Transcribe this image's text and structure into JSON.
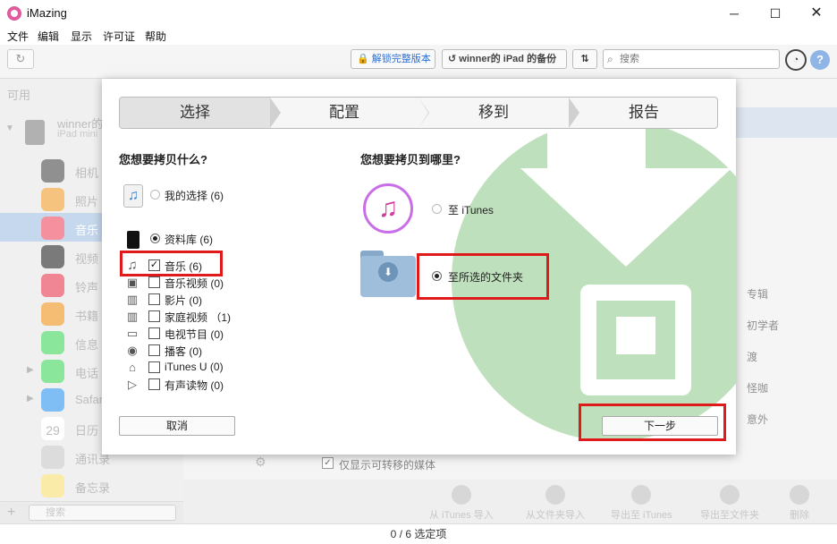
{
  "window": {
    "title": "iMazing",
    "min": "─",
    "max": "☐",
    "close": "✕"
  },
  "menu": [
    "文件",
    "编辑",
    "显示",
    "许可证",
    "帮助"
  ],
  "toolbar": {
    "unlock_label": "解锁完整版本",
    "backup_label": "winner的 iPad 的备份",
    "search_placeholder": "搜索"
  },
  "sidebar": {
    "header": "可用",
    "device_name": "winner的",
    "device_model": "iPad mini",
    "items": [
      {
        "label": "相机",
        "icon": "camera-icon",
        "color": "#555555"
      },
      {
        "label": "照片",
        "icon": "photos-icon",
        "color": "#f2a33a"
      },
      {
        "label": "音乐",
        "icon": "music-icon",
        "color": "#f0566b"
      },
      {
        "label": "视频",
        "icon": "video-icon",
        "color": "#333333"
      },
      {
        "label": "铃声",
        "icon": "ringtone-icon",
        "color": "#e8445a"
      },
      {
        "label": "书籍",
        "icon": "books-icon",
        "color": "#f09a2a"
      },
      {
        "label": "信息",
        "icon": "messages-icon",
        "color": "#4cd964"
      },
      {
        "label": "电话",
        "icon": "phone-icon",
        "color": "#4cd964"
      },
      {
        "label": "Safari",
        "icon": "safari-icon",
        "color": "#3a9bf0"
      },
      {
        "label": "日历",
        "icon": "calendar-icon",
        "color": "#ffffff"
      },
      {
        "label": "通讯录",
        "icon": "contacts-icon",
        "color": "#c9c9c9"
      },
      {
        "label": "备忘录",
        "icon": "notes-icon",
        "color": "#f7e27a"
      }
    ],
    "calendar_day": "29",
    "search_placeholder": "搜索"
  },
  "main": {
    "right_list": [
      "专辑",
      "初学者",
      "渡",
      "怪咖",
      "意外"
    ],
    "filter_label": "仅显示可转移的媒体",
    "bottom_tools": [
      "从 iTunes 导入",
      "从文件夹导入",
      "导出至 iTunes",
      "导出至文件夹",
      "删除"
    ]
  },
  "status": "0 / 6 选定项",
  "dialog": {
    "steps": [
      "选择",
      "配置",
      "移到",
      "报告"
    ],
    "active_step": "选择",
    "question_left": "您想要拷贝什么?",
    "question_right": "您想要拷贝到哪里?",
    "source_options": [
      {
        "label": "我的选择 (6)",
        "selected": false
      },
      {
        "label": "资料库 (6)",
        "selected": true
      }
    ],
    "categories": [
      {
        "label": "音乐 (6)",
        "checked": true,
        "icon": "music-note-icon"
      },
      {
        "label": "音乐视频 (0)",
        "checked": false,
        "icon": "music-video-icon"
      },
      {
        "label": "影片 (0)",
        "checked": false,
        "icon": "film-icon"
      },
      {
        "label": "家庭视频 （1)",
        "checked": false,
        "icon": "home-video-icon"
      },
      {
        "label": "电视节目 (0)",
        "checked": false,
        "icon": "tv-icon"
      },
      {
        "label": "播客 (0)",
        "checked": false,
        "icon": "podcast-icon"
      },
      {
        "label": "iTunes U (0)",
        "checked": false,
        "icon": "itunes-u-icon"
      },
      {
        "label": "有声读物 (0)",
        "checked": false,
        "icon": "audiobook-icon"
      }
    ],
    "destinations": [
      {
        "label": "至 iTunes",
        "selected": false
      },
      {
        "label": "至所选的文件夹",
        "selected": true
      }
    ],
    "cancel_label": "取消",
    "next_label": "下一步",
    "highlight_color": "#e01a1a"
  }
}
